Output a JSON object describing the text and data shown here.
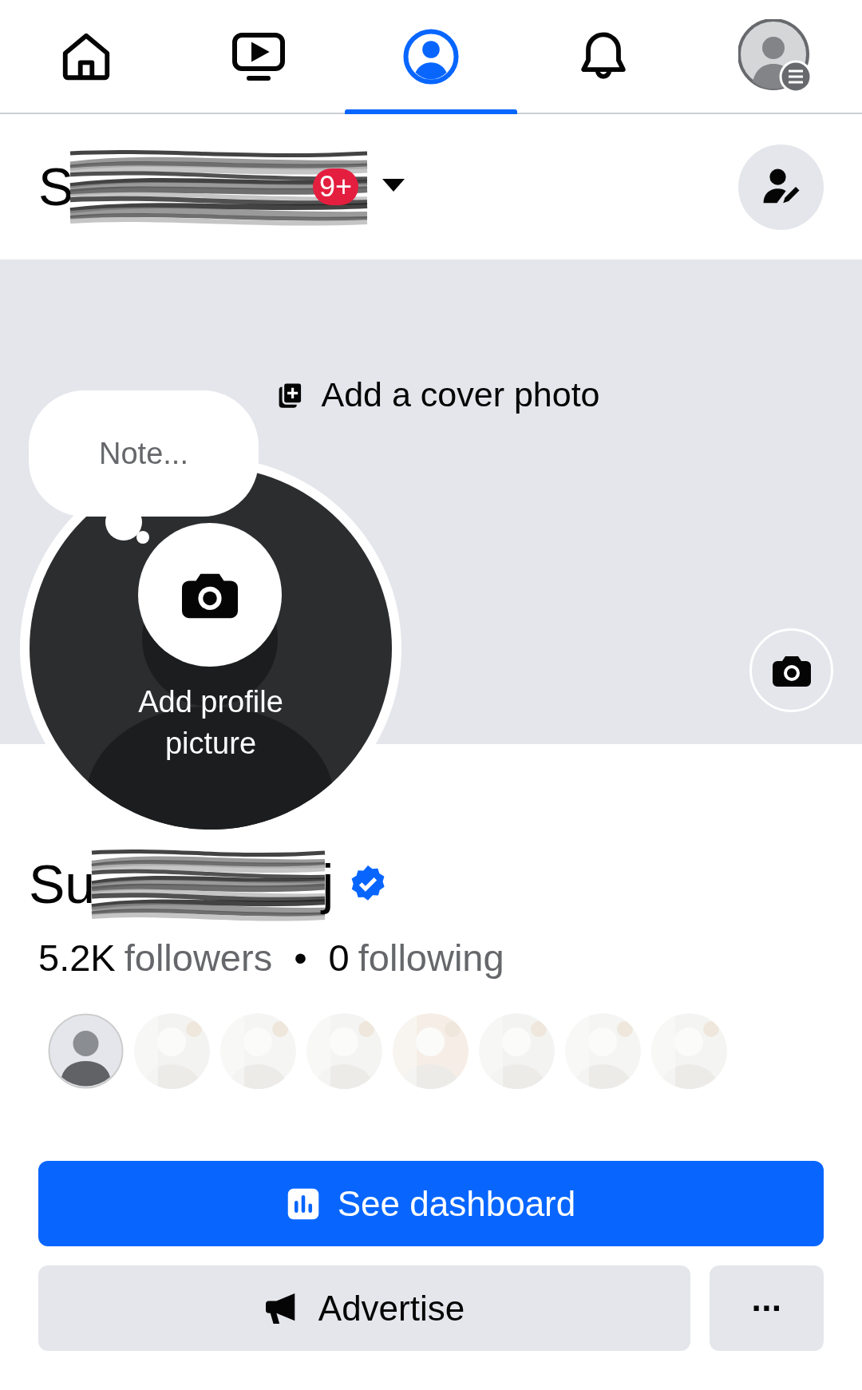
{
  "nav_tabs": [
    {
      "kind": "home",
      "selected": false
    },
    {
      "kind": "video",
      "selected": false
    },
    {
      "kind": "profile",
      "selected": true
    },
    {
      "kind": "bell",
      "selected": false
    },
    {
      "kind": "menu",
      "selected": false
    }
  ],
  "header": {
    "name": "S",
    "badge": "9+"
  },
  "cover": {
    "label": "Add a cover photo"
  },
  "note": {
    "placeholder": "Note..."
  },
  "profile_picture": {
    "label": "Add profile picture"
  },
  "profile": {
    "name_start": "Su",
    "name_end": "j",
    "verified": true,
    "followers_count": "5.2K",
    "followers_label": "followers",
    "separator": "•",
    "following_count": "0",
    "following_label": "following"
  },
  "follower_avatars": [
    {
      "kind": "default"
    },
    {
      "kind": "picture"
    },
    {
      "kind": "picture"
    },
    {
      "kind": "picture"
    },
    {
      "kind": "picture"
    },
    {
      "kind": "picture"
    },
    {
      "kind": "picture"
    },
    {
      "kind": "picture"
    }
  ],
  "buttons": [
    {
      "kind": "dashboard",
      "label": "See dashboard"
    },
    {
      "kind": "advertise",
      "label": "Advertise"
    },
    {
      "kind": "more",
      "label": "···"
    }
  ]
}
